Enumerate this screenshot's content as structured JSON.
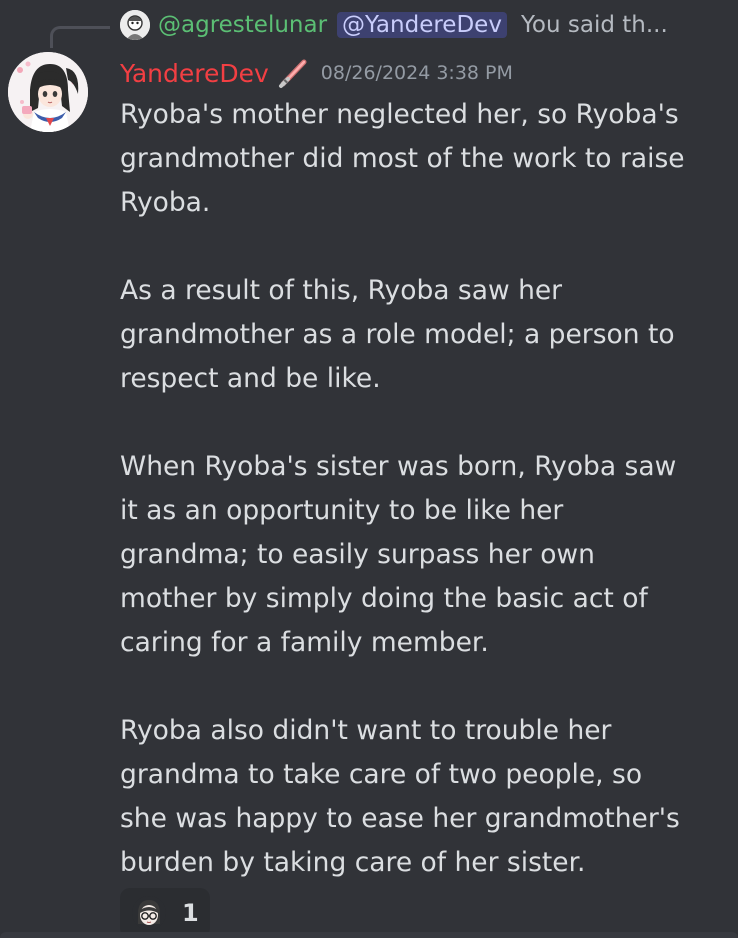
{
  "reply": {
    "author": "@agrestelunar",
    "mention": "@YandereDev",
    "preview": "You said th..."
  },
  "message": {
    "author": "YandereDev",
    "timestamp": "08/26/2024 3:38 PM",
    "paragraphs": [
      [
        "Ryoba's mother neglected her, so Ryoba's",
        "grandmother did most of the work to raise",
        "Ryoba."
      ],
      [
        "As a result of this, Ryoba saw her",
        "grandmother as a role model; a person to",
        "respect and be like."
      ],
      [
        "When Ryoba's sister was born, Ryoba saw",
        "it as an opportunity to be like her",
        "grandma; to easily surpass her own",
        "mother by simply doing the basic act of",
        "caring for a family member."
      ],
      [
        "Ryoba also didn't want to trouble her",
        "grandma to take care of two people, so",
        "she was happy to ease her grandmother's",
        "burden by taking care of her sister."
      ]
    ]
  },
  "reaction": {
    "emoji": "custom-anime-face-emoji",
    "count": "1"
  },
  "colors": {
    "background": "#313338",
    "text": "#dbdee1",
    "username": "#f23f43",
    "reply_author": "#5bbf74",
    "mention_text": "#c9cdfb",
    "muted": "#949ba4"
  },
  "icons": {
    "role": "lightsaber-icon"
  }
}
